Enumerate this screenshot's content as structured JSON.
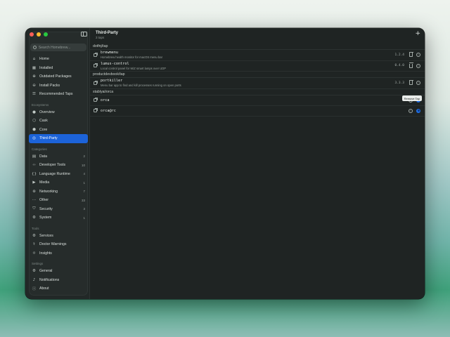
{
  "window": {
    "title": "Third-Party",
    "subtitle": "3 taps"
  },
  "sidebar": {
    "search_placeholder": "Search Homebrew...",
    "top_items": [
      {
        "label": "Home",
        "icon": "house-icon"
      },
      {
        "label": "Installed",
        "icon": "grid-icon"
      },
      {
        "label": "Outdated Packages",
        "icon": "arrow-up-circle-icon"
      },
      {
        "label": "Install Packs",
        "icon": "download-icon"
      },
      {
        "label": "Recommended Taps",
        "icon": "list-icon"
      }
    ],
    "ecosystems_label": "Ecosystems",
    "ecosystems": [
      {
        "label": "Overview",
        "icon": "circle-icon"
      },
      {
        "label": "Cask",
        "icon": "box-icon"
      },
      {
        "label": "Core",
        "icon": "cube-icon"
      },
      {
        "label": "Third-Party",
        "icon": "globe-icon",
        "active": true
      }
    ],
    "categories_label": "Categories",
    "categories": [
      {
        "label": "Data",
        "count": "2",
        "icon": "database-icon"
      },
      {
        "label": "Developer Tools",
        "count": "10",
        "icon": "code-icon"
      },
      {
        "label": "Language Runtime",
        "count": "4",
        "icon": "braces-icon"
      },
      {
        "label": "Media",
        "count": "1",
        "icon": "play-icon"
      },
      {
        "label": "Networking",
        "count": "7",
        "icon": "network-icon"
      },
      {
        "label": "Other",
        "count": "33",
        "icon": "ellipsis-icon"
      },
      {
        "label": "Security",
        "count": "3",
        "icon": "shield-icon"
      },
      {
        "label": "System",
        "count": "1",
        "icon": "gears-icon"
      }
    ],
    "tools_label": "Tools",
    "tools": [
      {
        "label": "Services",
        "icon": "services-icon"
      },
      {
        "label": "Doctor Warnings",
        "icon": "stethoscope-icon"
      },
      {
        "label": "Insights",
        "icon": "lightbulb-icon"
      }
    ],
    "settings_label": "Settings",
    "settings": [
      {
        "label": "General",
        "icon": "gear-icon"
      },
      {
        "label": "Notifications",
        "icon": "bell-icon"
      },
      {
        "label": "About",
        "icon": "info-icon"
      }
    ]
  },
  "groups": [
    {
      "name": "dotfnj/tap",
      "rows": [
        {
          "name": "brewmenu",
          "desc": "Homebrew health monitor for macOS menu bar",
          "version": "1.2.4"
        },
        {
          "name": "lumus-control",
          "desc": "Local control panel for WiZ smart lamps over UDP",
          "version": "0.4.0"
        }
      ]
    },
    {
      "name": "productdevbook/tap",
      "rows": [
        {
          "name": "portkiller",
          "desc": "Menu bar app to find and kill processes running on open ports",
          "version": "3.3.3"
        }
      ]
    },
    {
      "name": "stablyai/orca",
      "rows": [
        {
          "name": "orca",
          "desc": "",
          "version": ""
        },
        {
          "name": "orca@rc",
          "desc": "",
          "version": ""
        }
      ]
    }
  ],
  "tooltip": "Remove Tap",
  "colors": {
    "accent": "#1c63d9",
    "bg": "#1f2423",
    "sidebar": "#262c2b"
  }
}
